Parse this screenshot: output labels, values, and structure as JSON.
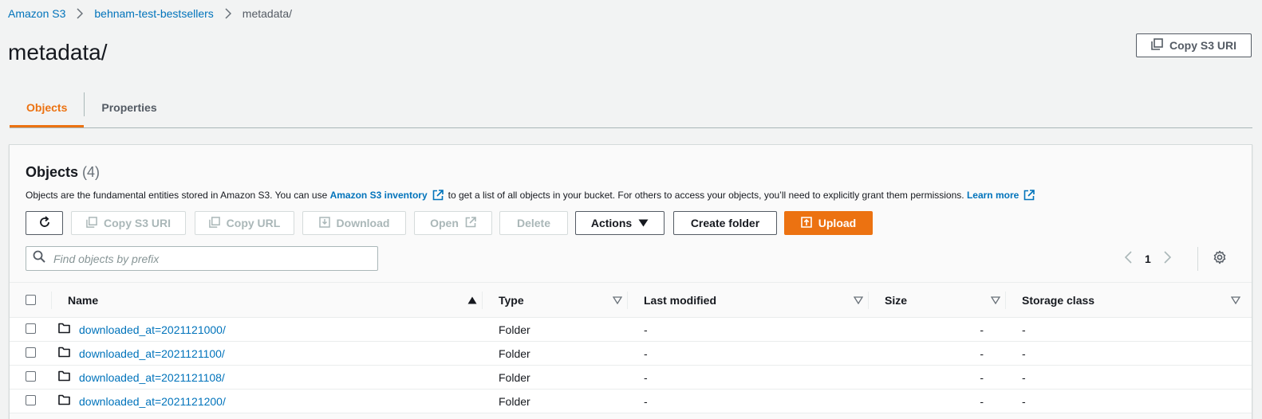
{
  "breadcrumb": {
    "items": [
      "Amazon S3",
      "behnam-test-bestsellers"
    ],
    "current": "metadata/"
  },
  "page": {
    "title": "metadata/",
    "copy_s3_uri_label": "Copy S3 URI"
  },
  "tabs": [
    {
      "label": "Objects",
      "active": true
    },
    {
      "label": "Properties",
      "active": false
    }
  ],
  "objects_panel": {
    "title": "Objects",
    "count": "(4)",
    "description_pre": "Objects are the fundamental entities stored in Amazon S3. You can use",
    "inventory_link": "Amazon S3 inventory",
    "description_mid": "to get a list of all objects in your bucket. For others to access your objects, you’ll need to explicitly grant them permissions.",
    "learn_more": "Learn more"
  },
  "toolbar": {
    "refresh_icon": "refresh-icon",
    "copy_s3_uri": "Copy S3 URI",
    "copy_url": "Copy URL",
    "download": "Download",
    "open": "Open",
    "delete": "Delete",
    "actions": "Actions",
    "create_folder": "Create folder",
    "upload": "Upload"
  },
  "search": {
    "placeholder": "Find objects by prefix",
    "value": ""
  },
  "pagination": {
    "page": "1"
  },
  "table": {
    "columns": [
      "Name",
      "Type",
      "Last modified",
      "Size",
      "Storage class"
    ],
    "rows": [
      {
        "name": "downloaded_at=2021121000/",
        "type": "Folder",
        "last_modified": "-",
        "size": "-",
        "storage_class": "-"
      },
      {
        "name": "downloaded_at=2021121100/",
        "type": "Folder",
        "last_modified": "-",
        "size": "-",
        "storage_class": "-"
      },
      {
        "name": "downloaded_at=2021121108/",
        "type": "Folder",
        "last_modified": "-",
        "size": "-",
        "storage_class": "-"
      },
      {
        "name": "downloaded_at=2021121200/",
        "type": "Folder",
        "last_modified": "-",
        "size": "-",
        "storage_class": "-"
      }
    ]
  },
  "colors": {
    "link": "#0073bb",
    "accent": "#ec7211",
    "text": "#16191f",
    "muted": "#545b64"
  }
}
